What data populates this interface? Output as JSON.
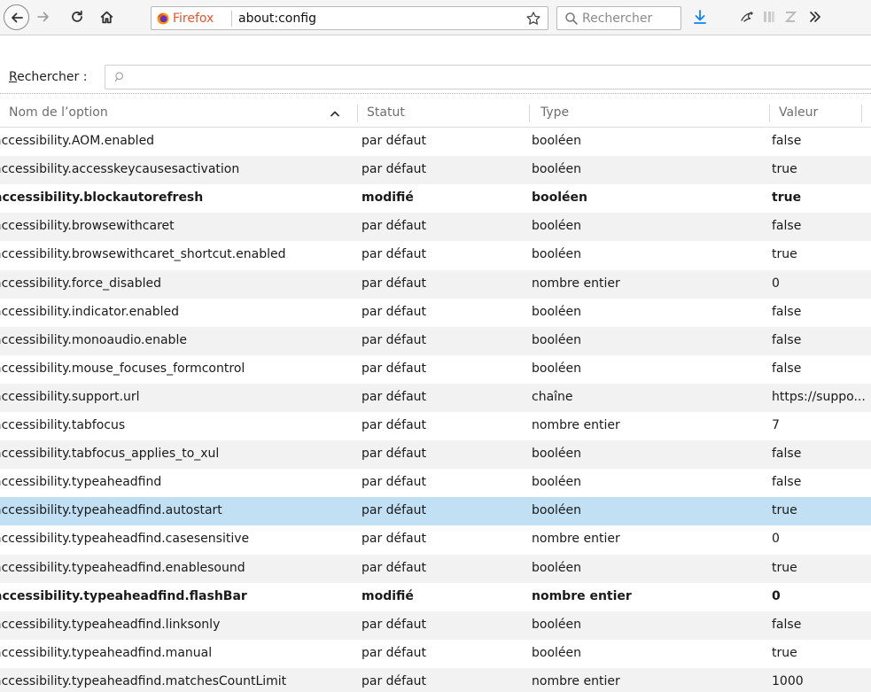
{
  "toolbar": {
    "back_icon": "back-arrow-icon",
    "forward_icon": "forward-arrow-icon",
    "reload_icon": "reload-icon",
    "home_icon": "home-icon",
    "url_identity": "Firefox",
    "url": "about:config",
    "search_placeholder": "Rechercher",
    "accent_color": "#0a84ff",
    "identity_color": "#e8532a"
  },
  "search": {
    "label_first": "R",
    "label_rest": "echercher :",
    "placeholder": ""
  },
  "table": {
    "columns": {
      "name": "Nom de l’option",
      "status": "Statut",
      "type": "Type",
      "value": "Valeur"
    },
    "rows": [
      {
        "name": "accessibility.AOM.enabled",
        "status": "par défaut",
        "type": "booléen",
        "value": "false",
        "modified": false,
        "selected": false
      },
      {
        "name": "accessibility.accesskeycausesactivation",
        "status": "par défaut",
        "type": "booléen",
        "value": "true",
        "modified": false,
        "selected": false
      },
      {
        "name": "accessibility.blockautorefresh",
        "status": "modifié",
        "type": "booléen",
        "value": "true",
        "modified": true,
        "selected": false
      },
      {
        "name": "accessibility.browsewithcaret",
        "status": "par défaut",
        "type": "booléen",
        "value": "false",
        "modified": false,
        "selected": false
      },
      {
        "name": "accessibility.browsewithcaret_shortcut.enabled",
        "status": "par défaut",
        "type": "booléen",
        "value": "true",
        "modified": false,
        "selected": false
      },
      {
        "name": "accessibility.force_disabled",
        "status": "par défaut",
        "type": "nombre entier",
        "value": "0",
        "modified": false,
        "selected": false
      },
      {
        "name": "accessibility.indicator.enabled",
        "status": "par défaut",
        "type": "booléen",
        "value": "false",
        "modified": false,
        "selected": false
      },
      {
        "name": "accessibility.monoaudio.enable",
        "status": "par défaut",
        "type": "booléen",
        "value": "false",
        "modified": false,
        "selected": false
      },
      {
        "name": "accessibility.mouse_focuses_formcontrol",
        "status": "par défaut",
        "type": "booléen",
        "value": "false",
        "modified": false,
        "selected": false
      },
      {
        "name": "accessibility.support.url",
        "status": "par défaut",
        "type": "chaîne",
        "value": "https://suppo...",
        "modified": false,
        "selected": false
      },
      {
        "name": "accessibility.tabfocus",
        "status": "par défaut",
        "type": "nombre entier",
        "value": "7",
        "modified": false,
        "selected": false
      },
      {
        "name": "accessibility.tabfocus_applies_to_xul",
        "status": "par défaut",
        "type": "booléen",
        "value": "false",
        "modified": false,
        "selected": false
      },
      {
        "name": "accessibility.typeaheadfind",
        "status": "par défaut",
        "type": "booléen",
        "value": "false",
        "modified": false,
        "selected": false
      },
      {
        "name": "accessibility.typeaheadfind.autostart",
        "status": "par défaut",
        "type": "booléen",
        "value": "true",
        "modified": false,
        "selected": true
      },
      {
        "name": "accessibility.typeaheadfind.casesensitive",
        "status": "par défaut",
        "type": "nombre entier",
        "value": "0",
        "modified": false,
        "selected": false
      },
      {
        "name": "accessibility.typeaheadfind.enablesound",
        "status": "par défaut",
        "type": "booléen",
        "value": "true",
        "modified": false,
        "selected": false
      },
      {
        "name": "accessibility.typeaheadfind.flashBar",
        "status": "modifié",
        "type": "nombre entier",
        "value": "0",
        "modified": true,
        "selected": false
      },
      {
        "name": "accessibility.typeaheadfind.linksonly",
        "status": "par défaut",
        "type": "booléen",
        "value": "false",
        "modified": false,
        "selected": false
      },
      {
        "name": "accessibility.typeaheadfind.manual",
        "status": "par défaut",
        "type": "booléen",
        "value": "true",
        "modified": false,
        "selected": false
      },
      {
        "name": "accessibility.typeaheadfind.matchesCountLimit",
        "status": "par défaut",
        "type": "nombre entier",
        "value": "1000",
        "modified": false,
        "selected": false
      }
    ]
  }
}
